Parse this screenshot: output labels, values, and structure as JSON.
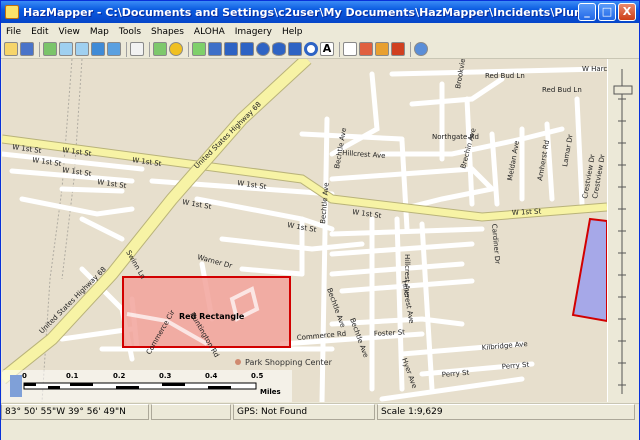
{
  "window": {
    "title": "HazMapper - C:\\Documents and Settings\\c2user\\My Documents\\HazMapper\\Incidents\\PlumesAndShapes.hzm",
    "minimize": "_",
    "maximize": "□",
    "close": "X"
  },
  "menu": [
    "File",
    "Edit",
    "View",
    "Map",
    "Tools",
    "Shapes",
    "ALOHA",
    "Imagery",
    "Help"
  ],
  "toolbar": {
    "icons": [
      "open-icon",
      "save-icon",
      "layers-icon",
      "zoom-in-icon",
      "zoom-out-icon",
      "zoom-extent-icon",
      "undo-icon",
      "pan-hand-icon",
      "locate-icon",
      "target-icon",
      "pencil-icon",
      "line-icon",
      "rectangle-icon",
      "polygon-icon",
      "circle-icon",
      "ellipse-icon",
      "bar-icon",
      "ring-icon",
      "text-icon",
      "pointer-icon",
      "plume-icon",
      "hazard-icon",
      "erase-icon",
      "help-icon"
    ],
    "text_glyph": "A"
  },
  "map": {
    "road_labels": [
      {
        "text": "W 1st St",
        "id": "w1st-a"
      },
      {
        "text": "W 1st St",
        "id": "w1st-b"
      },
      {
        "text": "W 1st St",
        "id": "w1st-c"
      },
      {
        "text": "W 1st St",
        "id": "w1st-d"
      },
      {
        "text": "W 1st St",
        "id": "w1st-e"
      },
      {
        "text": "W 1st St",
        "id": "w1st-f"
      },
      {
        "text": "W 1st St",
        "id": "w1st-g"
      },
      {
        "text": "W 1st St",
        "id": "w1st-h"
      },
      {
        "text": "W 1st St",
        "id": "w1st-i"
      },
      {
        "text": "W 1st St",
        "id": "w1st-j"
      },
      {
        "text": "W 1st St",
        "id": "w1st-k"
      },
      {
        "text": "United States Highway 68",
        "id": "hwy68-a"
      },
      {
        "text": "United States Highway 68",
        "id": "hwy68-b"
      },
      {
        "text": "Hillcrest Ave",
        "id": "hillcrest-a"
      },
      {
        "text": "Hillcrest Ave",
        "id": "hillcrest-b"
      },
      {
        "text": "Hillcrest Ave",
        "id": "hillcrest-c"
      },
      {
        "text": "Northgate Rd",
        "id": "northgate"
      },
      {
        "text": "Red Bud Ln",
        "id": "redbud-a"
      },
      {
        "text": "Red Bud Ln",
        "id": "redbud-b"
      },
      {
        "text": "Brookview Dr",
        "id": "brookview"
      },
      {
        "text": "Brechin Ave",
        "id": "brechin"
      },
      {
        "text": "Meldan Ave",
        "id": "meldan"
      },
      {
        "text": "Amherst Rd",
        "id": "amherst"
      },
      {
        "text": "Lamar Dr",
        "id": "lamar"
      },
      {
        "text": "Crestview Dr",
        "id": "crestview-a"
      },
      {
        "text": "Crestview Dr",
        "id": "crestview-b"
      },
      {
        "text": "W Harc",
        "id": "wharc"
      },
      {
        "text": "Bechtle Ave",
        "id": "bechtle-a"
      },
      {
        "text": "Bechtle Ave",
        "id": "bechtle-b"
      },
      {
        "text": "Bechtle Ave",
        "id": "bechtle-c"
      },
      {
        "text": "Bechtle Ave",
        "id": "bechtle-d"
      },
      {
        "text": "Commerce Rd",
        "id": "commerce"
      },
      {
        "text": "Commerce Cir",
        "id": "commerce-cir"
      },
      {
        "text": "Foster St",
        "id": "foster"
      },
      {
        "text": "Kilbridge Ave",
        "id": "kilbridge"
      },
      {
        "text": "Perry St",
        "id": "perry-a"
      },
      {
        "text": "Perry St",
        "id": "perry-b"
      },
      {
        "text": "Hyer Ave",
        "id": "hyer"
      },
      {
        "text": "Swinn Ln",
        "id": "swinn"
      },
      {
        "text": "Warner Dr",
        "id": "warner"
      },
      {
        "text": "Huntington Rd",
        "id": "huntington"
      },
      {
        "text": "Cardiner Dr",
        "id": "cardiner"
      }
    ],
    "shape_label": "Red Rectangle",
    "poi_label": "Park Shopping Center",
    "colors": {
      "background": "#e7dfcd",
      "road": "#ffffff",
      "highway": "#f7f3a5",
      "rectangle_fill": "#f2a39b",
      "rectangle_stroke": "#d20000",
      "polygon_fill": "#a6a8e8"
    },
    "scale": {
      "ticks": [
        "0",
        "0.1",
        "0.2",
        "0.3",
        "0.4",
        "0.5"
      ],
      "unit": "Miles"
    }
  },
  "status": {
    "coords": "83° 50' 55\"W   39° 56' 49\"N",
    "gps": "GPS: Not Found",
    "scale": "Scale 1:9,629"
  }
}
